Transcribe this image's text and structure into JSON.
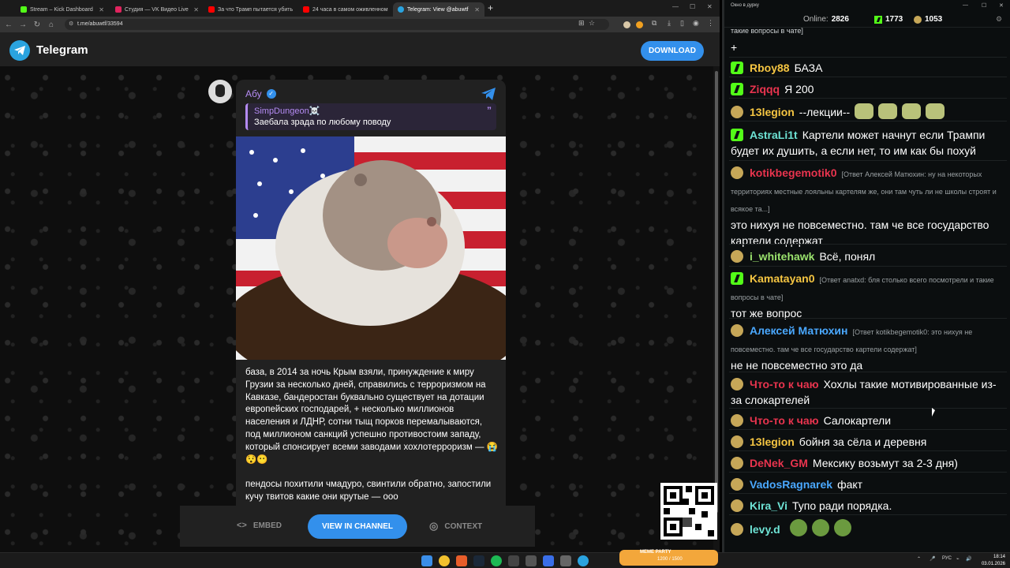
{
  "browser": {
    "tabs": [
      {
        "title": "Stream – Kick Dashboard",
        "favicon_color": "#53fc18"
      },
      {
        "title": "Студия — VK Видео Live",
        "favicon_color": "#e0245e"
      },
      {
        "title": "За что Трамп пытается убить",
        "favicon_color": "#ff0000"
      },
      {
        "title": "24 часа в самом оживленном",
        "favicon_color": "#ff0000"
      },
      {
        "title": "Telegram: View @abuwtf",
        "favicon_color": "#2aa3df"
      }
    ],
    "url": "t.me/abuwtf/33594"
  },
  "telegram": {
    "brand": "Telegram",
    "download_label": "DOWNLOAD",
    "post": {
      "author": "Абу",
      "reply_name": "SimpDungeon☠️",
      "reply_text": "Заебала зрада по любому поводу",
      "text_p1": "база, в 2014 за ночь Крым взяли, принуждение к миру Грузии за несколько дней, справились с терроризмом на Кавказе, бандеростан буквально существует на дотации европейских господарей, + несколько миллионов населения и ЛДНР, сотни тыщ порков перемалываются, под миллионом санкций успешно противостоим западу, который спонсирует всеми заводами хохлотерроризм — 😭😯😶",
      "text_p2": "пендосы похитили чмадуро, свинтили обратно, запостили кучу твитов какие они крутые — ооо"
    },
    "bottom": {
      "embed": "EMBED",
      "view": "VIEW IN CHANNEL",
      "context": "CONTEXT"
    }
  },
  "chat": {
    "window_title": "Окно в дурку",
    "online_label": "Online:",
    "online_count": "2826",
    "kick_count": "1773",
    "emote_count": "1053",
    "top_fragment": "такие вопросы в чате]",
    "plus": "+",
    "messages": [
      {
        "nick": "Rboy88",
        "color": "#f5c542",
        "badge": "kick",
        "text": "БАЗА"
      },
      {
        "nick": "Ziqqq",
        "color": "#e8344e",
        "badge": "kick",
        "text": "Я 200"
      },
      {
        "nick": "13legion",
        "color": "#f5c542",
        "badge": "emo",
        "text": "--лекции--"
      },
      {
        "nick": "AstraLi1t",
        "color": "#6ee3d5",
        "badge": "kick",
        "text": "Картели может начнут если Трампи будет их душить, а если нет, то им как бы похуй"
      },
      {
        "nick": "kotikbegemotik0",
        "color": "#e8344e",
        "badge": "emo",
        "reply": "[Ответ Алексей Матюхин: ну на некоторых территориях местные лояльны картелям же, они там чуть ли не школы строят и всякое та...]",
        "text": "это нихуя не повсеместно. там че все государство картели содержат"
      },
      {
        "nick": "i_whitehawk",
        "color": "#9be36e",
        "badge": "emo",
        "text": "Всё, понял"
      },
      {
        "nick": "Kamatayan0",
        "color": "#f5c542",
        "badge": "kick",
        "reply": "[Ответ anatxd: бля столько всего посмотрели и такие вопросы в чате]",
        "text": "тот же вопрос"
      },
      {
        "nick": "Алексей Матюхин",
        "color": "#4aa8ff",
        "badge": "emo",
        "reply": "[Ответ kotikbegemotik0: это нихуя не повсеместно. там че все государство картели содержат]",
        "text": "не не повсеместно это да"
      },
      {
        "nick": "Что-то к чаю",
        "color": "#e8344e",
        "badge": "emo",
        "text": "Хохлы такие мотивированные из-за слокартелей"
      },
      {
        "nick": "Что-то к чаю",
        "color": "#e8344e",
        "badge": "emo",
        "text": "Салокартели"
      },
      {
        "nick": "13legion",
        "color": "#f5c542",
        "badge": "emo",
        "text": "бойня  за  сёла и деревня"
      },
      {
        "nick": "DeNek_GM",
        "color": "#e8344e",
        "badge": "emo",
        "text": "Мексику возьмут за 2-3 дня)"
      },
      {
        "nick": "VadosRagnarek",
        "color": "#4aa8ff",
        "badge": "emo",
        "text": "факт"
      },
      {
        "nick": "Kira_Vi",
        "color": "#6ee3d5",
        "badge": "emo",
        "text": "Тупо ради порядка."
      },
      {
        "nick": "levy.d",
        "color": "#6ee3d5",
        "badge": "emo",
        "text": ""
      }
    ]
  },
  "taskbar": {
    "lang": "РУС",
    "time": "18:14",
    "date": "03.01.2026",
    "meme_label": "MEME PARTY",
    "meme_value": "1200 / 1500"
  }
}
